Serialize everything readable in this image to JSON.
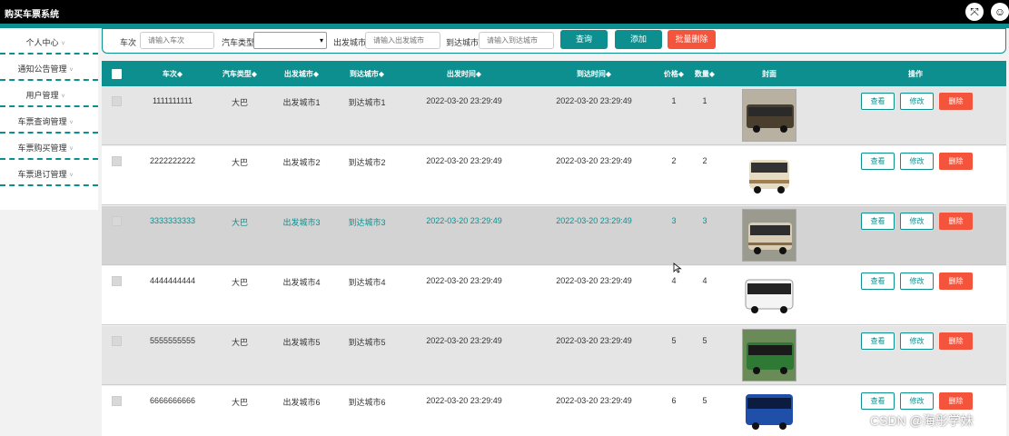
{
  "app": {
    "title": "购买车票系统"
  },
  "sidebar": {
    "items": [
      {
        "label": "个人中心"
      },
      {
        "label": "通知公告管理"
      },
      {
        "label": "用户管理"
      },
      {
        "label": "车票查询管理"
      },
      {
        "label": "车票购买管理"
      },
      {
        "label": "车票退订管理"
      }
    ],
    "caret": "˅"
  },
  "filters": {
    "train_no": {
      "label": "车次",
      "placeholder": "请输入车次"
    },
    "bus_type": {
      "label": "汽车类型",
      "value": ""
    },
    "depart_city": {
      "label": "出发城市",
      "placeholder": "请输入出发城市"
    },
    "arrive_city": {
      "label": "到达城市",
      "placeholder": "请输入到达城市"
    },
    "query_label": "查询",
    "add_label": "添加",
    "batch_delete_label": "批量删除"
  },
  "table": {
    "headers": {
      "train_no": "车次◆",
      "bus_type": "汽车类型◆",
      "depart_city": "出发城市◆",
      "arrive_city": "到达城市◆",
      "depart_time": "出发时间◆",
      "arrive_time": "到达时间◆",
      "price": "价格◆",
      "quantity": "数量◆",
      "cover": "封面",
      "actions": "操作"
    },
    "rows": [
      {
        "train_no": "1111111111",
        "bus_type": "大巴",
        "depart_city": "出发城市1",
        "arrive_city": "到达城市1",
        "depart_time": "2022-03-20 23:29:49",
        "arrive_time": "2022-03-20 23:29:49",
        "price": "1",
        "quantity": "1",
        "cover_color": "#8a7a55"
      },
      {
        "train_no": "2222222222",
        "bus_type": "大巴",
        "depart_city": "出发城市2",
        "arrive_city": "到达城市2",
        "depart_time": "2022-03-20 23:29:49",
        "arrive_time": "2022-03-20 23:29:49",
        "price": "2",
        "quantity": "2",
        "cover_color": "#e8e2d4"
      },
      {
        "train_no": "3333333333",
        "bus_type": "大巴",
        "depart_city": "出发城市3",
        "arrive_city": "到达城市3",
        "depart_time": "2022-03-20 23:29:49",
        "arrive_time": "2022-03-20 23:29:49",
        "price": "3",
        "quantity": "3",
        "cover_color": "#c9c0ae"
      },
      {
        "train_no": "4444444444",
        "bus_type": "大巴",
        "depart_city": "出发城市4",
        "arrive_city": "到达城市4",
        "depart_time": "2022-03-20 23:29:49",
        "arrive_time": "2022-03-20 23:29:49",
        "price": "4",
        "quantity": "4",
        "cover_color": "#f0f0f0"
      },
      {
        "train_no": "5555555555",
        "bus_type": "大巴",
        "depart_city": "出发城市5",
        "arrive_city": "到达城市5",
        "depart_time": "2022-03-20 23:29:49",
        "arrive_time": "2022-03-20 23:29:49",
        "price": "5",
        "quantity": "5",
        "cover_color": "#3f8f3a"
      },
      {
        "train_no": "6666666666",
        "bus_type": "大巴",
        "depart_city": "出发城市6",
        "arrive_city": "到达城市6",
        "depart_time": "2022-03-20 23:29:49",
        "arrive_time": "2022-03-20 23:29:49",
        "price": "6",
        "quantity": "5",
        "cover_color": "#1f4fa8"
      }
    ],
    "view_label": "查看",
    "edit_label": "修改",
    "delete_label": "删除"
  },
  "watermark": "CSDN @海彤学妹",
  "colors": {
    "accent": "#0e8f8f",
    "danger": "#f4543c"
  }
}
